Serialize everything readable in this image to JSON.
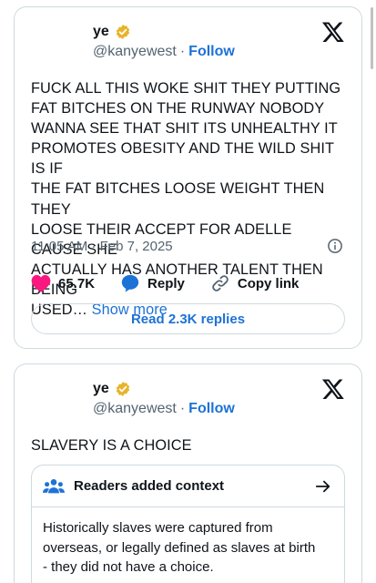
{
  "tweets": [
    {
      "display_name": "ye",
      "handle": "@kanyewest",
      "separator": "·",
      "follow_label": "Follow",
      "text": "FUCK ALL THIS WOKE SHIT  THEY PUTTING\nFAT BITCHES ON THE RUNWAY   NOBODY\nWANNA SEE THAT SHIT  ITS UNHEALTHY  IT\nPROMOTES OBESITY AND THE WILD SHIT IS IF\nTHE FAT BITCHES LOOSE WEIGHT THEN THEY\nLOOSE THEIR ACCEPT FOR ADELLE CAUSE SHE\nACTUALLY HAS ANOTHER TALENT THEN BEING\nUSED…",
      "show_more_label": "Show more",
      "timestamp": "11:05 AM · Feb 7, 2025",
      "likes": "65.7K",
      "reply_label": "Reply",
      "copy_link_label": "Copy link",
      "read_replies_label": "Read 2.3K replies"
    },
    {
      "display_name": "ye",
      "handle": "@kanyewest",
      "separator": "·",
      "follow_label": "Follow",
      "text": "SLAVERY IS A CHOICE",
      "context_title": "Readers added context",
      "context_text": "Historically slaves were captured from\noverseas, or legally defined as slaves at birth\n- they did not have a choice."
    }
  ],
  "colors": {
    "link": "#1d72d6",
    "like": "#f91880",
    "verified": "#e8b32a",
    "border": "#cfd9de",
    "muted": "#536471"
  }
}
